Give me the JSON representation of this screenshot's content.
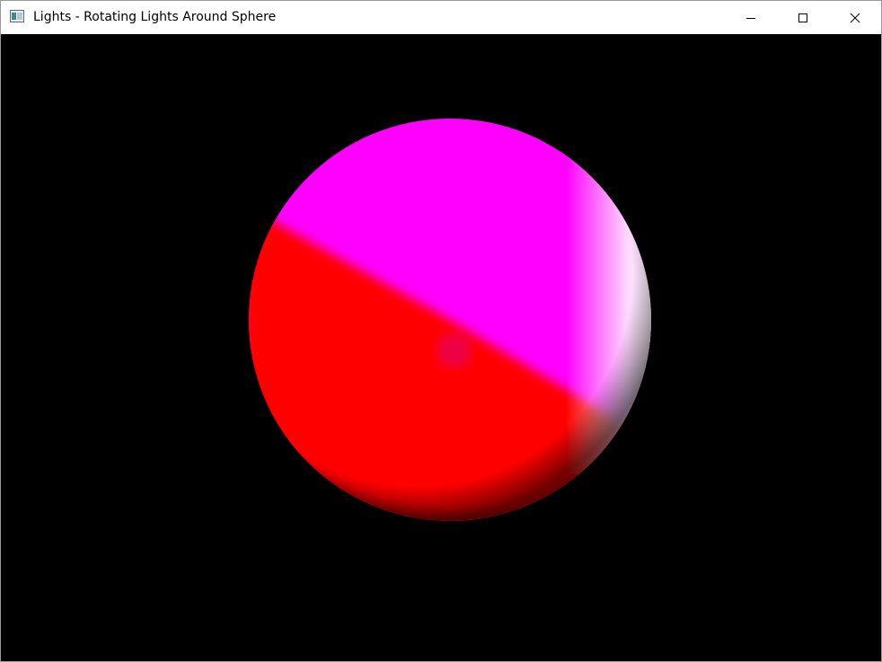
{
  "window": {
    "title": "Lights - Rotating Lights Around Sphere",
    "controls": {
      "minimize_icon": "minimize-icon",
      "maximize_icon": "maximize-icon",
      "close_icon": "close-icon"
    }
  },
  "scene": {
    "background": "#000000",
    "sphere_colors": {
      "lit_top": "#ff00ff",
      "lit_bottom": "#ff0000",
      "highlight": "#ffffff",
      "rim_green": "#00ff00",
      "rim_cyan": "#00ffff"
    }
  }
}
